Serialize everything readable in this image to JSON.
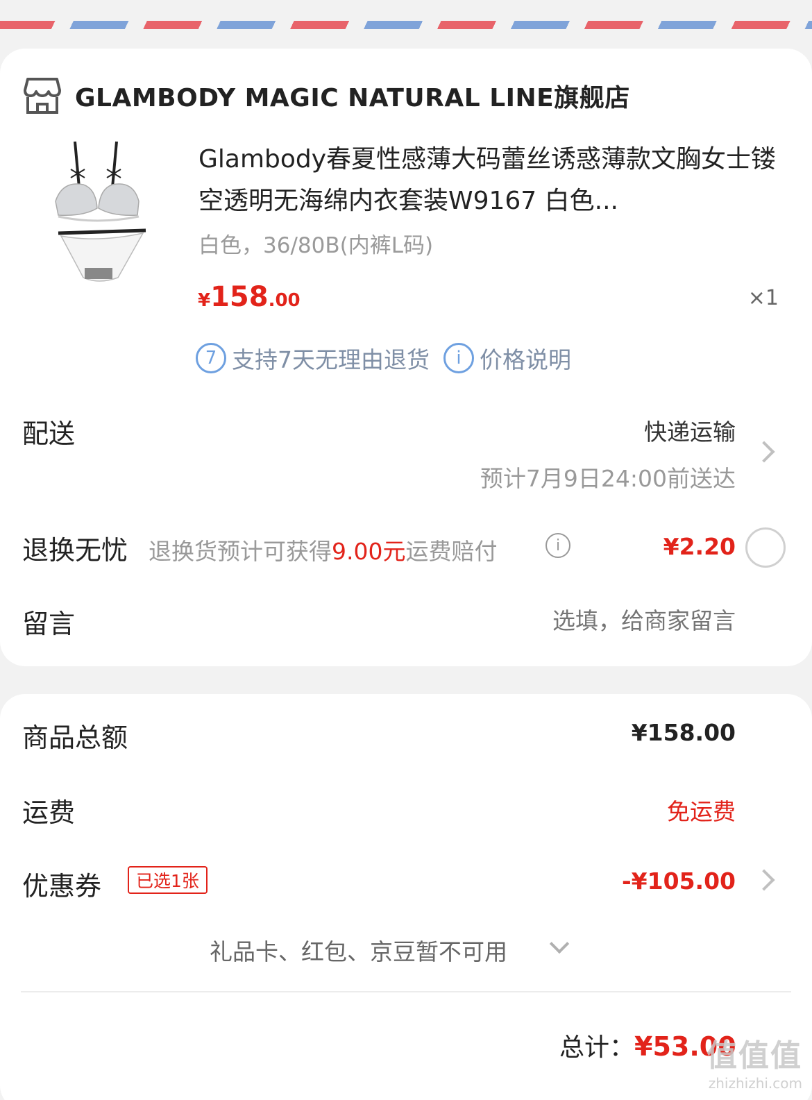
{
  "store": {
    "icon": "store-icon",
    "name": "GLAMBODY MAGIC NATURAL LINE旗舰店"
  },
  "product": {
    "title": "Glambody春夏性感薄大码蕾丝诱惑薄款文胸女士镂空透明无海绵内衣套装W9167 白色...",
    "spec": "白色，36/80B(内裤L码)",
    "price_currency": "¥",
    "price_int": "158",
    "price_dec": ".00",
    "qty": "×1",
    "services": [
      {
        "icon": "7",
        "label": "支持7天无理由退货"
      },
      {
        "icon": "i",
        "label": "价格说明"
      }
    ]
  },
  "delivery": {
    "label": "配送",
    "method": "快递运输",
    "eta": "预计7月9日24:00前送达"
  },
  "return_insurance": {
    "label": "退换无忧",
    "desc_prefix": "退换货预计可获得",
    "desc_amount": "9.00元",
    "desc_suffix": "运费赔付",
    "price": "¥2.20",
    "selected": false
  },
  "message": {
    "label": "留言",
    "placeholder": "选填，给商家留言"
  },
  "summary": {
    "goods_label": "商品总额",
    "goods_value": "¥158.00",
    "freight_label": "运费",
    "freight_value": "免运费",
    "coupon_label": "优惠券",
    "coupon_tag": "已选1张",
    "coupon_value": "-¥105.00",
    "unavailable": "礼品卡、红包、京豆暂不可用",
    "total_label": "总计：",
    "total_value": "¥53.00"
  },
  "watermark": {
    "logo": "值值值",
    "url": "zhizhizhi.com"
  },
  "colors": {
    "accent_red": "#e2231a",
    "service_blue": "#6ea0e0",
    "airmail_red": "#e8636a",
    "airmail_blue": "#7fa3d9"
  }
}
